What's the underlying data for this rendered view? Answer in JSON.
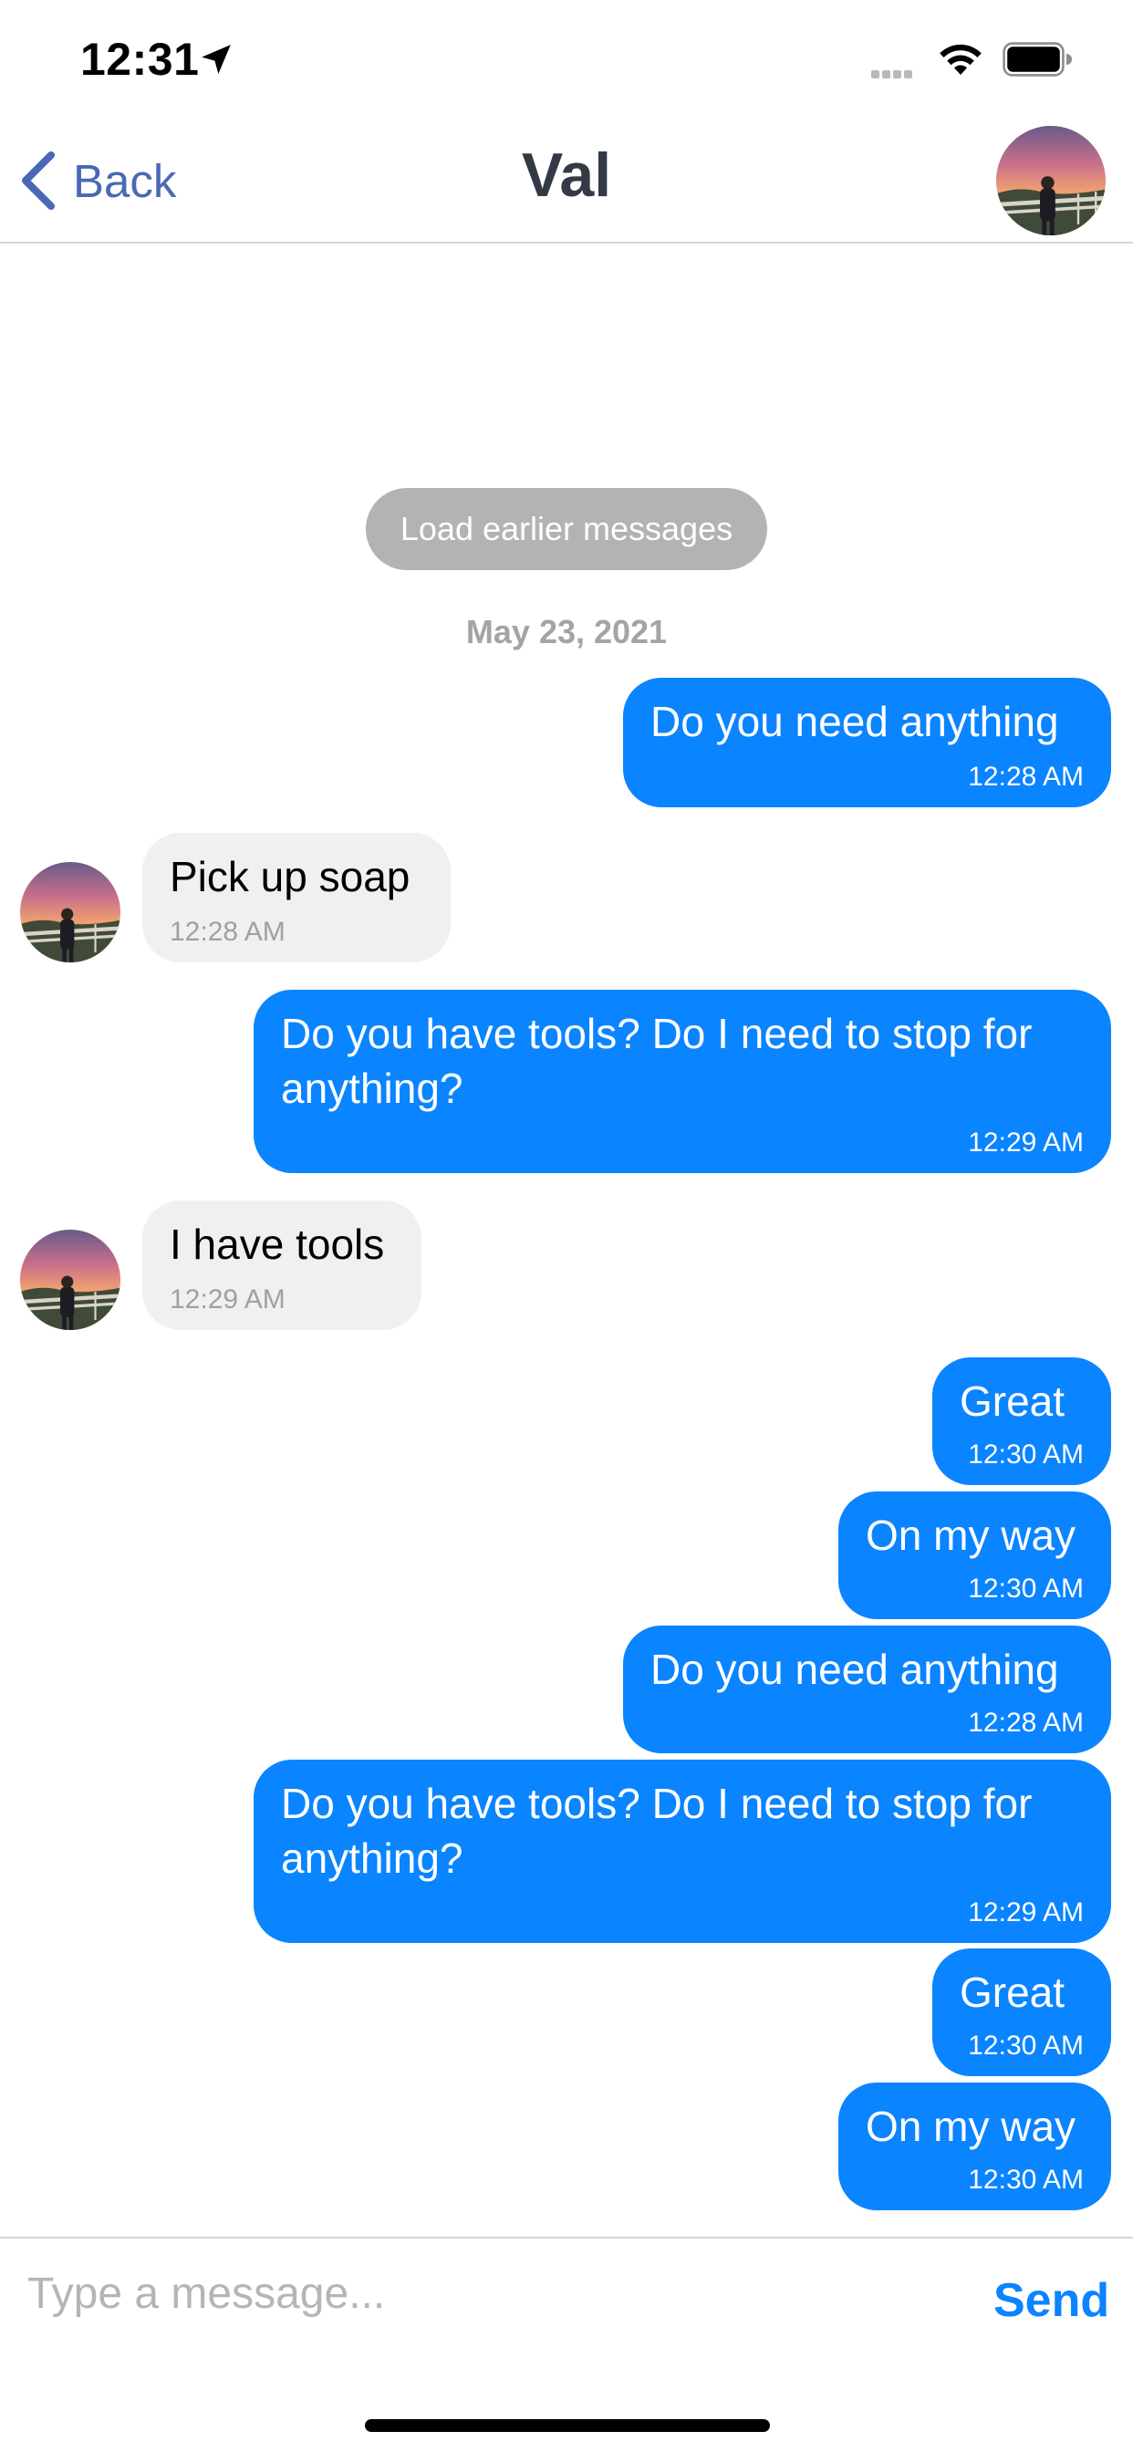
{
  "status_bar": {
    "time": "12:31",
    "icons": [
      "location-arrow-icon",
      "signal-icon",
      "wifi-icon",
      "battery-icon"
    ]
  },
  "header": {
    "back_label": "Back",
    "title": "Val",
    "avatar": "contact-avatar"
  },
  "thread": {
    "load_earlier_label": "Load earlier messages",
    "date": "May 23, 2021",
    "messages": [
      {
        "direction": "outgoing",
        "text": "Do you need anything",
        "time": "12:28 AM"
      },
      {
        "direction": "incoming",
        "text": "Pick up soap",
        "time": "12:28 AM"
      },
      {
        "direction": "outgoing",
        "text": "Do you have tools? Do I need to stop for anything?",
        "time": "12:29 AM"
      },
      {
        "direction": "incoming",
        "text": "I have tools",
        "time": "12:29 AM"
      },
      {
        "direction": "outgoing",
        "text": "Great",
        "time": "12:30 AM"
      },
      {
        "direction": "outgoing",
        "text": "On my way",
        "time": "12:30 AM"
      },
      {
        "direction": "outgoing",
        "text": "Do you need anything",
        "time": "12:28 AM"
      },
      {
        "direction": "outgoing",
        "text": "Do you have tools? Do I need to stop for anything?",
        "time": "12:29 AM"
      },
      {
        "direction": "outgoing",
        "text": "Great",
        "time": "12:30 AM"
      },
      {
        "direction": "outgoing",
        "text": "On my way",
        "time": "12:30 AM"
      }
    ]
  },
  "composer": {
    "placeholder": "Type a message...",
    "value": "",
    "send_label": "Send"
  },
  "colors": {
    "outgoing_bubble": "#0a84ff",
    "incoming_bubble": "#f0f0f0",
    "back_link": "#4a68b5",
    "title": "#333a45",
    "send": "#0a84ff"
  }
}
